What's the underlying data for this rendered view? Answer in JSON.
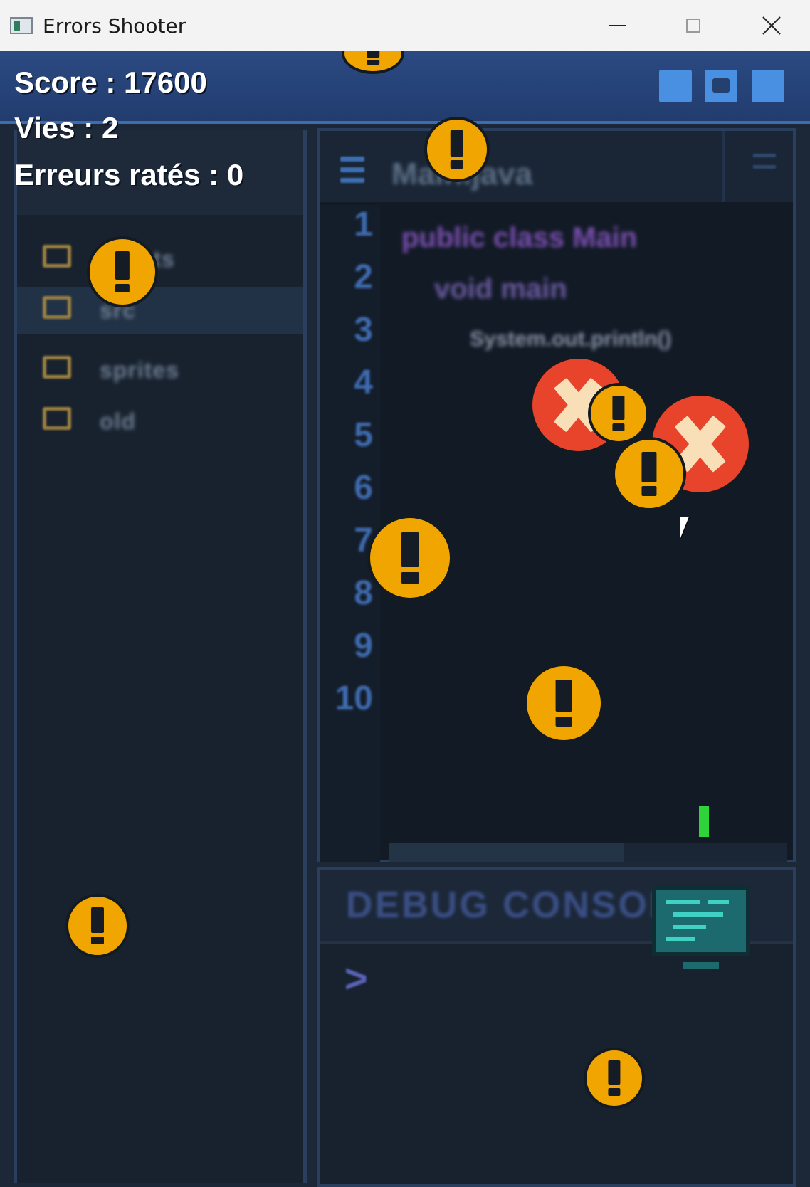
{
  "window": {
    "title": "Errors Shooter",
    "minimize_label": "",
    "maximize_label": "",
    "close_label": ""
  },
  "hud": {
    "score": "Score : 17600",
    "lives": "Vies : 2",
    "missed": "Erreurs ratés : 0"
  },
  "background_ide": {
    "file_tab": "Main.java",
    "folders": [
      "assets",
      "src",
      "sprites",
      "old"
    ],
    "line_numbers": [
      "1",
      "2",
      "3",
      "4",
      "5",
      "6",
      "7",
      "8",
      "9",
      "10"
    ],
    "code": {
      "line1": "public class Main",
      "line2": "void main",
      "line3": "System.out.println()"
    },
    "console_title": "DEBUG CONSOLE",
    "console_prompt": ">"
  },
  "sprites": {
    "warning_icon": "exclamation-warning-icon",
    "error_icon": "red-x-error-icon",
    "player_icon": "computer-monitor-icon"
  },
  "colors": {
    "warning": "#f0a500",
    "error": "#e8432b",
    "caret": "#2fd33a",
    "accent": "#3e6cb0"
  }
}
